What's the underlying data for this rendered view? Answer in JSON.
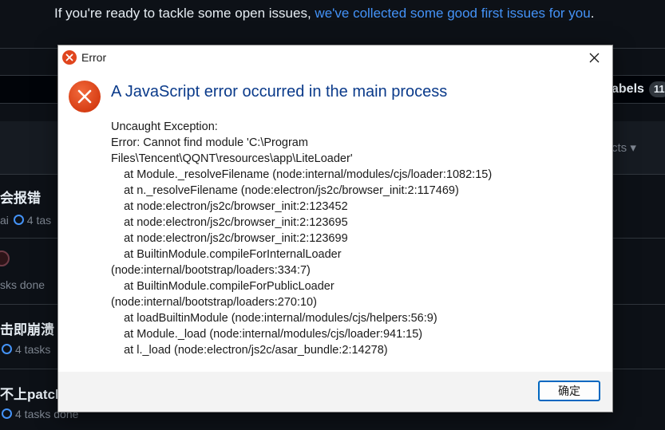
{
  "background": {
    "banner_prefix": "If you're ready to tackle some open issues, ",
    "banner_link": "we've collected some good first issues for you",
    "banner_suffix": ".",
    "labels_label": "abels",
    "labels_count": "11",
    "projects_label": "cts",
    "issues": [
      {
        "title": "会报错",
        "meta": "ai",
        "tasks": "4 tas"
      },
      {
        "title": "",
        "meta": "sks done",
        "tasks": ""
      },
      {
        "title": "击即崩溃",
        "meta": "",
        "tasks": "4 tasks"
      },
      {
        "title": "不上patch",
        "meta": "",
        "tasks": "4 tasks done"
      }
    ]
  },
  "dialog": {
    "window_title": "Error",
    "main_instruction": "A JavaScript error occurred in the main process",
    "message": "Uncaught Exception:\nError: Cannot find module 'C:\\Program\nFiles\\Tencent\\QQNT\\resources\\app\\LiteLoader'\n    at Module._resolveFilename (node:internal/modules/cjs/loader:1082:15)\n    at n._resolveFilename (node:electron/js2c/browser_init:2:117469)\n    at node:electron/js2c/browser_init:2:123452\n    at node:electron/js2c/browser_init:2:123695\n    at node:electron/js2c/browser_init:2:123699\n    at BuiltinModule.compileForInternalLoader\n(node:internal/bootstrap/loaders:334:7)\n    at BuiltinModule.compileForPublicLoader\n(node:internal/bootstrap/loaders:270:10)\n    at loadBuiltinModule (node:internal/modules/cjs/helpers:56:9)\n    at Module._load (node:internal/modules/cjs/loader:941:15)\n    at l._load (node:electron/js2c/asar_bundle:2:14278)",
    "ok_label": "确定"
  },
  "colors": {
    "error_red": "#e0451d",
    "instruction_blue": "#0a3a8a",
    "link_blue": "#4493f8",
    "button_focus": "#0067c0"
  }
}
